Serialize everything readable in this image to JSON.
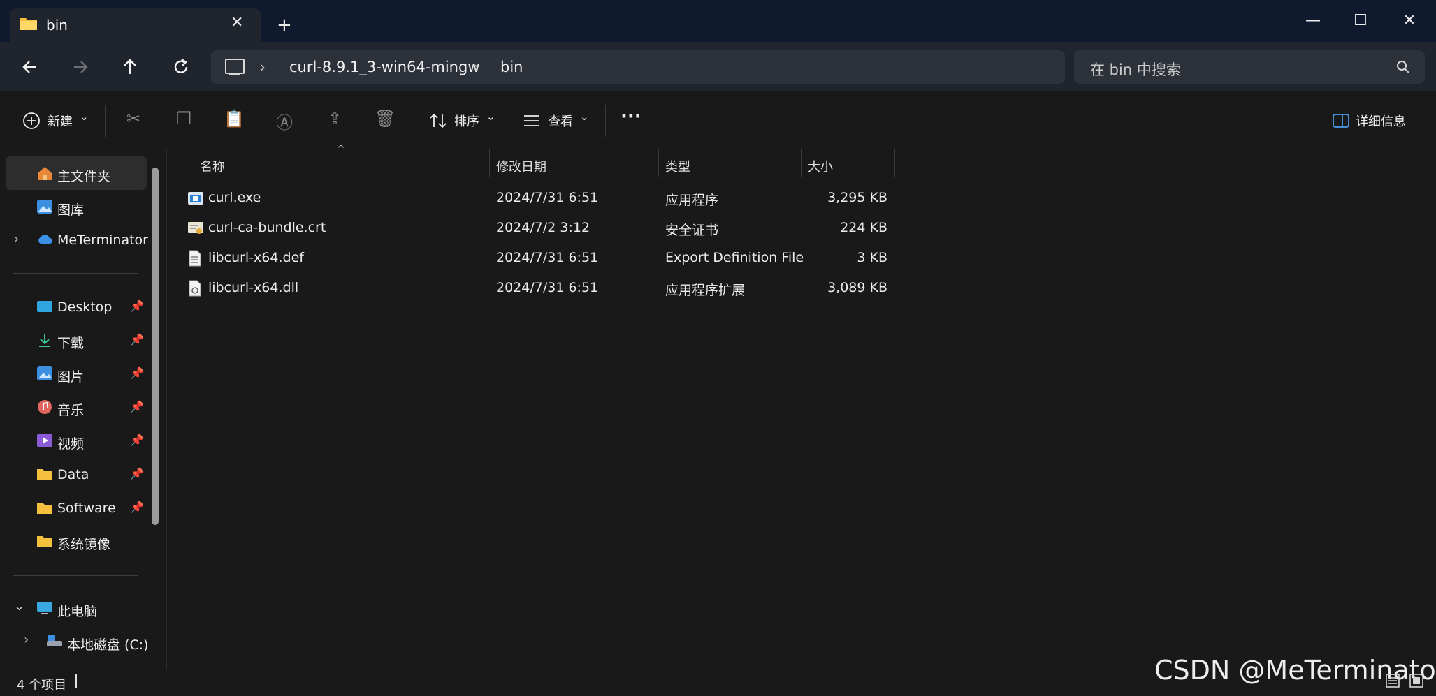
{
  "window": {
    "tab_title": "bin",
    "minimize_glyph": "—",
    "maximize_glyph": "☐",
    "close_glyph": "✕",
    "tab_close_glyph": "✕",
    "new_tab_glyph": "+"
  },
  "nav": {
    "back_icon": "arrow-left-icon",
    "forward_icon": "arrow-right-icon",
    "up_icon": "arrow-up-icon",
    "refresh_icon": "refresh-icon"
  },
  "address": {
    "crumbs": [
      "curl-8.9.1_3-win64-mingw",
      "bin"
    ]
  },
  "search": {
    "placeholder": "在 bin 中搜索"
  },
  "toolbar": {
    "new_label": "新建",
    "sort_label": "排序",
    "view_label": "查看",
    "more_glyph": "···",
    "details_label": "详细信息"
  },
  "sidebar": {
    "home": "主文件夹",
    "gallery": "图库",
    "onedrive": "MeTerminator",
    "quick": [
      {
        "label": "Desktop",
        "pinned": true
      },
      {
        "label": "下载",
        "pinned": true
      },
      {
        "label": "图片",
        "pinned": true
      },
      {
        "label": "音乐",
        "pinned": true
      },
      {
        "label": "视频",
        "pinned": true
      },
      {
        "label": "Data",
        "pinned": true
      },
      {
        "label": "Software",
        "pinned": true
      },
      {
        "label": "系统镜像",
        "pinned": false
      }
    ],
    "this_pc": "此电脑",
    "drive_c": "本地磁盘 (C:)"
  },
  "table": {
    "headers": {
      "name": "名称",
      "modified": "修改日期",
      "type": "类型",
      "size": "大小"
    },
    "rows": [
      {
        "name": "curl.exe",
        "modified": "2024/7/31 6:51",
        "type": "应用程序",
        "size": "3,295 KB",
        "icon": "exe-icon"
      },
      {
        "name": "curl-ca-bundle.crt",
        "modified": "2024/7/2 3:12",
        "type": "安全证书",
        "size": "224 KB",
        "icon": "certificate-icon"
      },
      {
        "name": "libcurl-x64.def",
        "modified": "2024/7/31 6:51",
        "type": "Export Definition File",
        "size": "3 KB",
        "icon": "text-file-icon"
      },
      {
        "name": "libcurl-x64.dll",
        "modified": "2024/7/31 6:51",
        "type": "应用程序扩展",
        "size": "3,089 KB",
        "icon": "dll-file-icon"
      }
    ]
  },
  "status": {
    "item_count": "4 个项目"
  },
  "watermark": "CSDN @MeTerminator",
  "colors": {
    "titlebar": "#0f1a2e",
    "navbar": "#20252d",
    "content_bg": "#191919",
    "folder_yellow": "#f5c03d",
    "accent_blue": "#4a9ae8"
  }
}
